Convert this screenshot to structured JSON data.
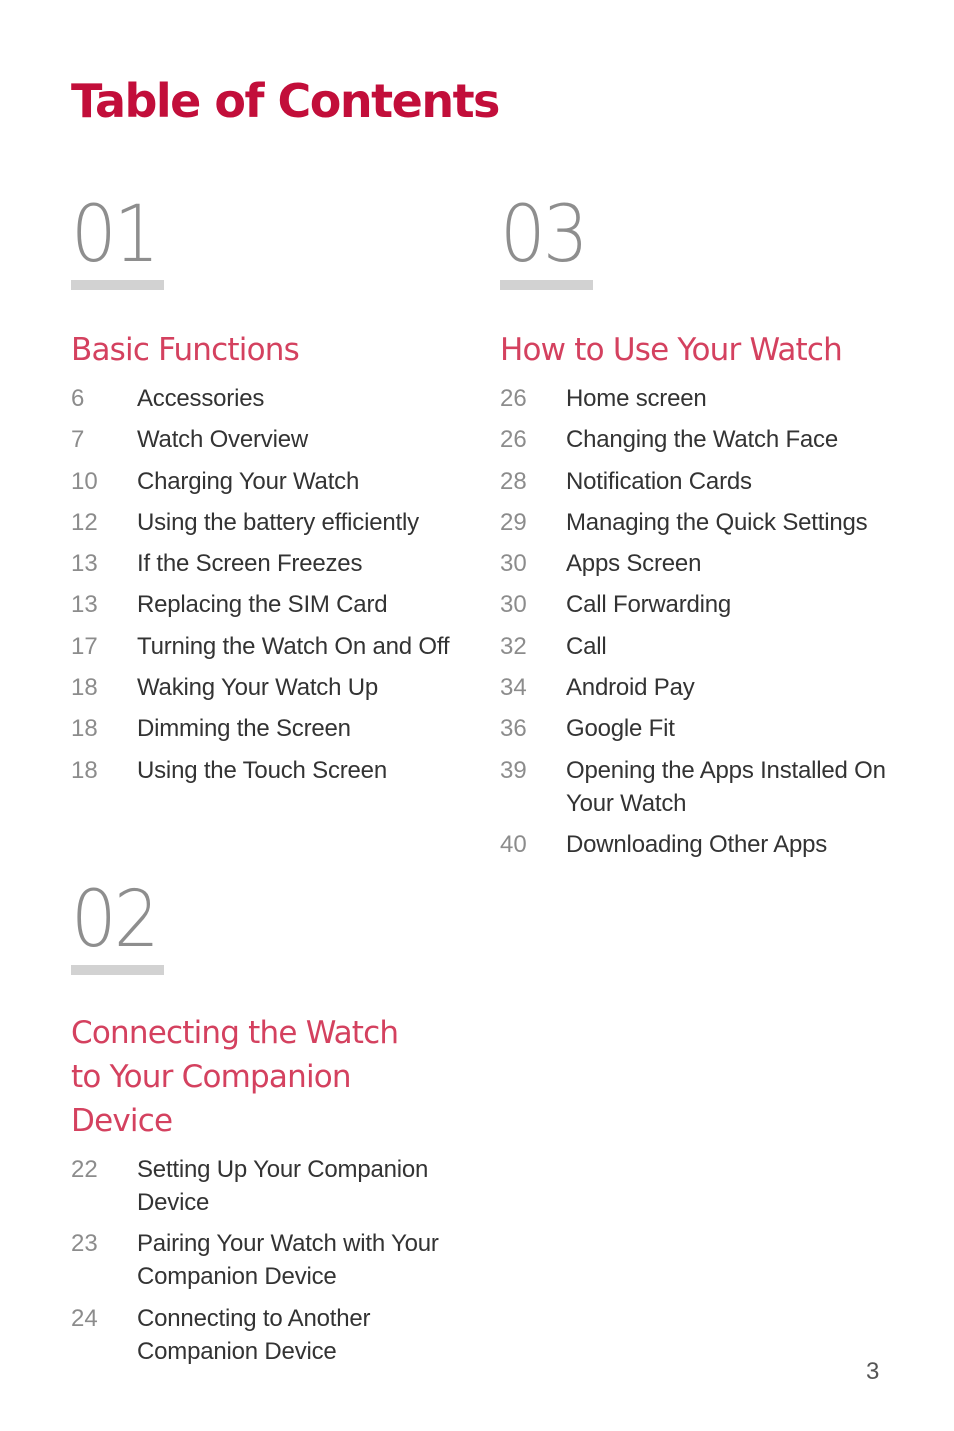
{
  "title": "Table of Contents",
  "colors": {
    "title": "#c20e3a",
    "section_title": "#d4415f",
    "section_number": "#8e8e8e",
    "bar": "#d2d2d2"
  },
  "sections": [
    {
      "number": "01",
      "title": "Basic Functions",
      "entries": [
        {
          "page": "6",
          "title": "Accessories"
        },
        {
          "page": "7",
          "title": "Watch Overview"
        },
        {
          "page": "10",
          "title": "Charging Your Watch"
        },
        {
          "page": "12",
          "title": "Using the battery efficiently"
        },
        {
          "page": "13",
          "title": "If the Screen Freezes"
        },
        {
          "page": "13",
          "title": "Replacing the SIM Card"
        },
        {
          "page": "17",
          "title": "Turning the Watch On and Off"
        },
        {
          "page": "18",
          "title": "Waking Your Watch Up"
        },
        {
          "page": "18",
          "title": "Dimming the Screen"
        },
        {
          "page": "18",
          "title": "Using the Touch Screen"
        }
      ]
    },
    {
      "number": "02",
      "title": "Connecting the Watch to Your Companion Device",
      "entries": [
        {
          "page": "22",
          "title": "Setting Up Your Companion Device"
        },
        {
          "page": "23",
          "title": "Pairing Your Watch with Your Companion Device"
        },
        {
          "page": "24",
          "title": "Connecting to Another Companion Device"
        }
      ]
    },
    {
      "number": "03",
      "title": "How to Use Your Watch",
      "entries": [
        {
          "page": "26",
          "title": "Home screen"
        },
        {
          "page": "26",
          "title": "Changing the Watch Face"
        },
        {
          "page": "28",
          "title": "Notification Cards"
        },
        {
          "page": "29",
          "title": "Managing the Quick Settings"
        },
        {
          "page": "30",
          "title": "Apps Screen"
        },
        {
          "page": "30",
          "title": "Call Forwarding"
        },
        {
          "page": "32",
          "title": "Call"
        },
        {
          "page": "34",
          "title": "Android Pay"
        },
        {
          "page": "36",
          "title": "Google Fit"
        },
        {
          "page": "39",
          "title": "Opening the Apps Installed On Your Watch"
        },
        {
          "page": "40",
          "title": "Downloading Other Apps"
        }
      ]
    }
  ],
  "page_number": "3"
}
